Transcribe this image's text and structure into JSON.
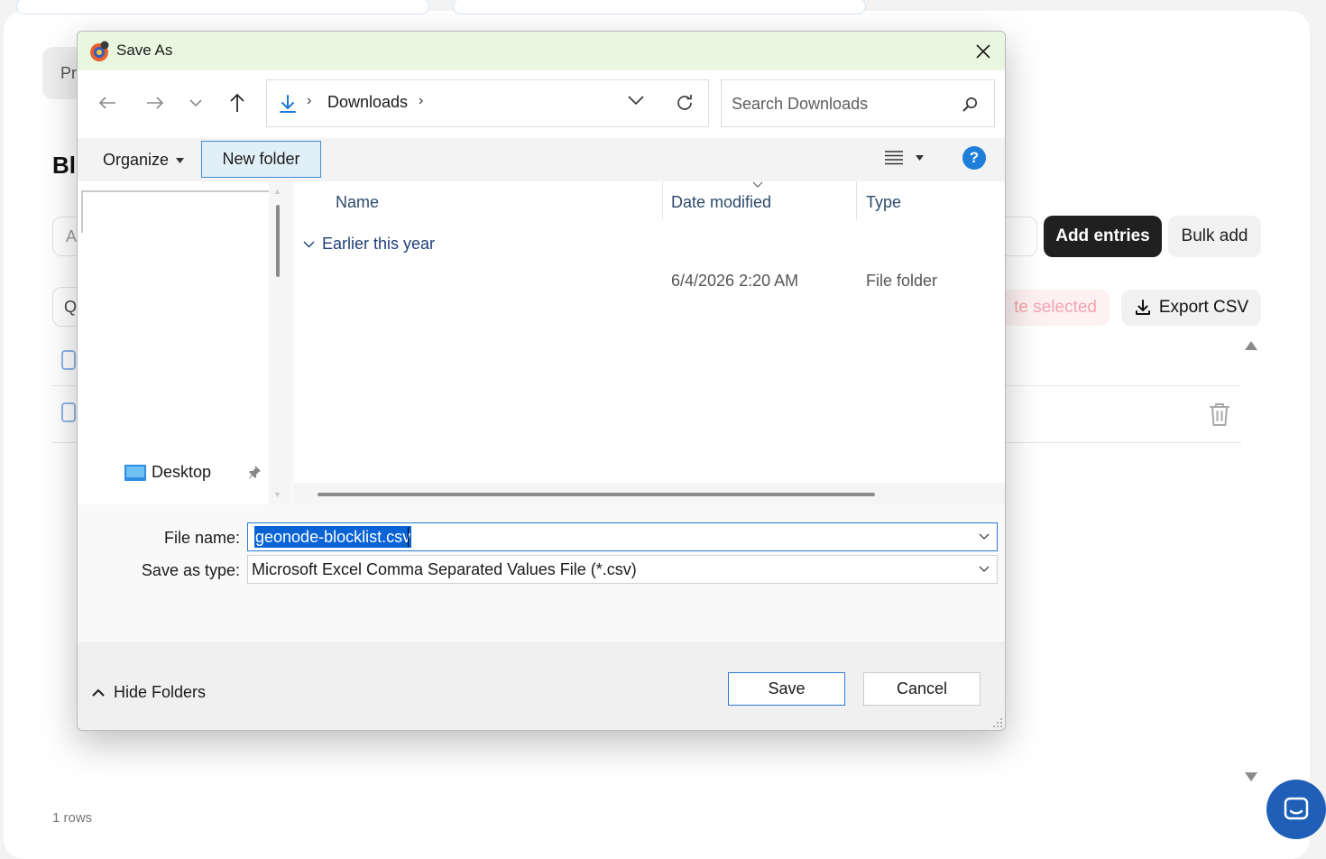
{
  "background_page": {
    "tab_label": "Pr",
    "heading": "Bl",
    "add_input_placeholder": "A",
    "search_label": "Q",
    "add_entries_label": "Add entries",
    "bulk_add_label": "Bulk add",
    "delete_selected_label": "te selected",
    "export_csv_label": "Export CSV",
    "rows_count": "1 rows"
  },
  "dialog": {
    "title": "Save As",
    "address": {
      "folder": "Downloads",
      "separator": "›"
    },
    "search_placeholder": "Search Downloads",
    "toolbar": {
      "organize_label": "Organize",
      "new_folder_label": "New folder",
      "help_label": "?"
    },
    "navigation_pane": {
      "items": [
        {
          "label": "Desktop",
          "icon": "desktop-folder-icon",
          "pinned": true
        }
      ]
    },
    "file_list": {
      "columns": [
        "Name",
        "Date modified",
        "Type"
      ],
      "groups": [
        {
          "label": "Earlier this year",
          "rows": [
            {
              "name": "",
              "date_modified": "6/4/2026 2:20 AM",
              "type": "File folder"
            }
          ]
        }
      ]
    },
    "file_name_label": "File name:",
    "file_name_value": "geonode-blocklist.csv",
    "save_as_type_label": "Save as type:",
    "save_as_type_value": "Microsoft Excel Comma Separated Values File (*.csv)",
    "hide_folders_label": "Hide Folders",
    "save_label": "Save",
    "cancel_label": "Cancel"
  },
  "colors": {
    "titlebar": "#e9f6e0",
    "accent": "#2c7ad4",
    "selection": "#0a64d6",
    "dark_button": "#202020",
    "delete_text": "#f4a3ad"
  }
}
